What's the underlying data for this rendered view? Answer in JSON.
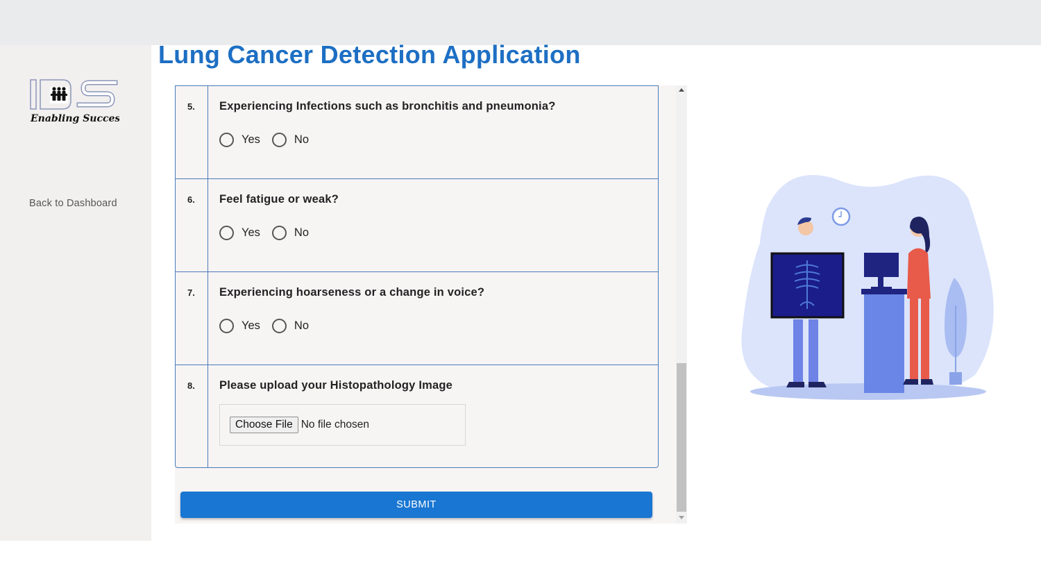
{
  "app": {
    "title": "Lung Cancer Detection Application"
  },
  "sidebar": {
    "logo_tagline": "Enabling Success",
    "back_link": "Back to Dashboard"
  },
  "questions": [
    {
      "number": "5.",
      "text": "Experiencing Infections such as bronchitis and pneumonia?",
      "options": [
        "Yes",
        "No"
      ]
    },
    {
      "number": "6.",
      "text": "Feel fatigue or weak?",
      "options": [
        "Yes",
        "No"
      ]
    },
    {
      "number": "7.",
      "text": "Experiencing hoarseness or a change in voice?",
      "options": [
        "Yes",
        "No"
      ]
    }
  ],
  "upload": {
    "number": "8.",
    "text": "Please upload your Histopathology Image",
    "button_label": "Choose File",
    "status": "No file chosen"
  },
  "submit_label": "SUBMIT",
  "colors": {
    "accent": "#1976d2",
    "title": "#1d6fc3",
    "border": "#4a7bb8"
  }
}
